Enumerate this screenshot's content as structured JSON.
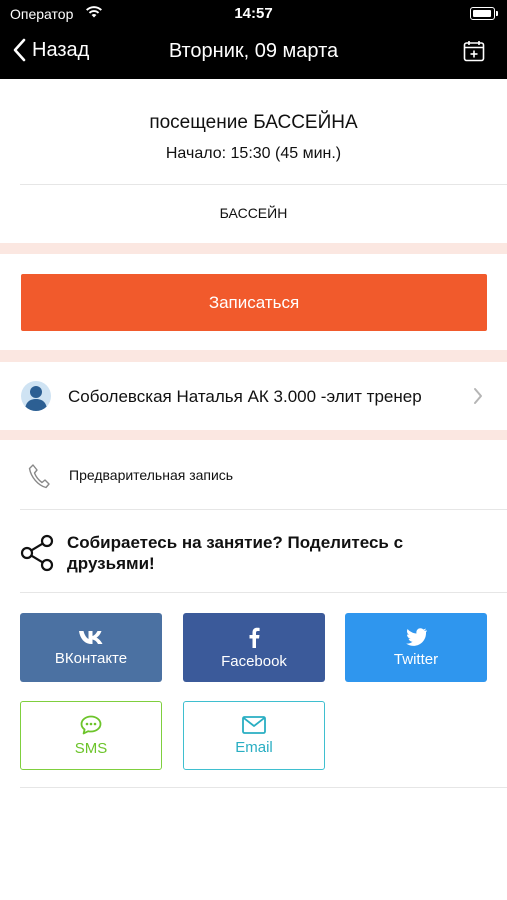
{
  "status_bar": {
    "carrier": "Оператор",
    "time": "14:57"
  },
  "nav": {
    "back_label": "Назад",
    "title": "Вторник, 09 марта"
  },
  "event": {
    "title": "посещение БАССЕЙНА",
    "start": "Начало: 15:30 (45 мин.)",
    "category": "БАССЕЙН"
  },
  "signup": {
    "label": "Записаться"
  },
  "trainer": {
    "name": "Соболевская Наталья АК 3.000 -элит тренер"
  },
  "booking": {
    "label": "Предварительная запись"
  },
  "share": {
    "prompt": "Собираетесь на занятие? Поделитесь с друзьями!",
    "buttons": {
      "vk": "ВКонтакте",
      "facebook": "Facebook",
      "twitter": "Twitter",
      "sms": "SMS",
      "email": "Email"
    }
  },
  "colors": {
    "signup": "#f15a2c",
    "band": "#fbe7e1",
    "vk": "#4b71a2",
    "facebook": "#3b5a9a",
    "twitter": "#2f96ee",
    "sms": "#7fcf3e",
    "email": "#3fbfcf"
  },
  "icons": [
    "wifi-icon",
    "battery-icon",
    "back-chevron-icon",
    "calendar-add-icon",
    "avatar-icon",
    "chevron-right-icon",
    "phone-icon",
    "share-icon",
    "vk-icon",
    "facebook-icon",
    "twitter-icon",
    "sms-icon",
    "mail-icon"
  ]
}
